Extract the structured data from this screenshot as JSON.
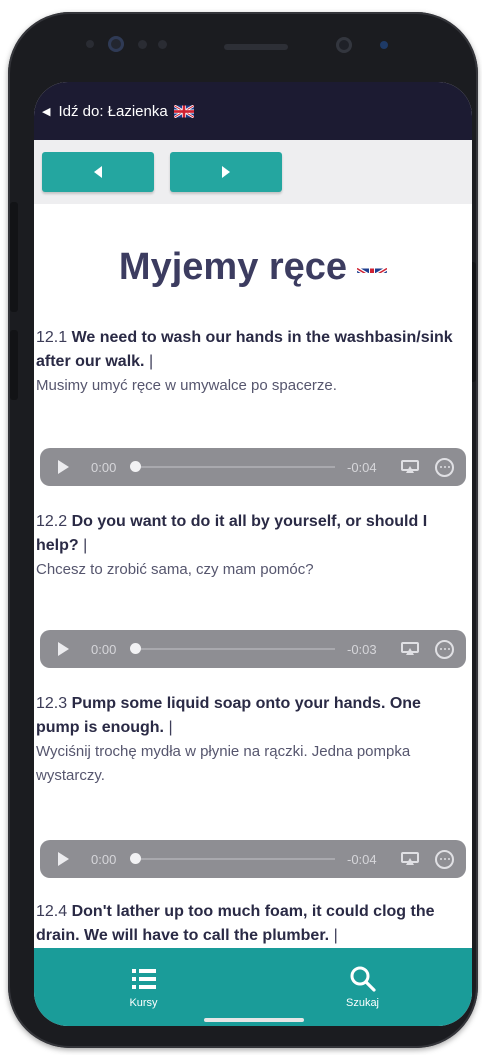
{
  "header": {
    "title": "Idź do: Łazienka"
  },
  "nav": {
    "prev_icon": "triangle-left-icon",
    "next_icon": "triangle-right-icon"
  },
  "page": {
    "title": "Myjemy ręce"
  },
  "entries": [
    {
      "number": "12.1",
      "english": "We need to wash our hands in the washbasin/sink after our walk.",
      "separator": "|",
      "polish": "Musimy umyć ręce w umywalce po spacerze.",
      "audio": {
        "current": "0:00",
        "remaining": "-0:04",
        "progress": 0
      }
    },
    {
      "number": "12.2",
      "english": "Do you want to do it all by yourself, or should I help?",
      "separator": "|",
      "polish": "Chcesz to zrobić sama, czy mam pomóc?",
      "audio": {
        "current": "0:00",
        "remaining": "-0:03",
        "progress": 0
      }
    },
    {
      "number": "12.3",
      "english": "Pump some liquid soap onto your hands. One pump is enough.",
      "separator": "|",
      "polish": "Wyciśnij trochę mydła w płynie na rączki. Jedna pompka wystarczy.",
      "audio": {
        "current": "0:00",
        "remaining": "-0:04",
        "progress": 0
      }
    },
    {
      "number": "12.4",
      "english": "Don't lather up too much foam, it could clog the drain. We will have to call the plumber.",
      "separator": "|"
    }
  ],
  "bottom_nav": {
    "items": [
      {
        "label": "Kursy",
        "icon": "list-icon"
      },
      {
        "label": "Szukaj",
        "icon": "search-icon"
      }
    ]
  },
  "colors": {
    "accent": "#24a6a0",
    "title_bar": "#1c1b32",
    "audio_bar": "#8e8e93",
    "heading": "#3c3c60"
  }
}
